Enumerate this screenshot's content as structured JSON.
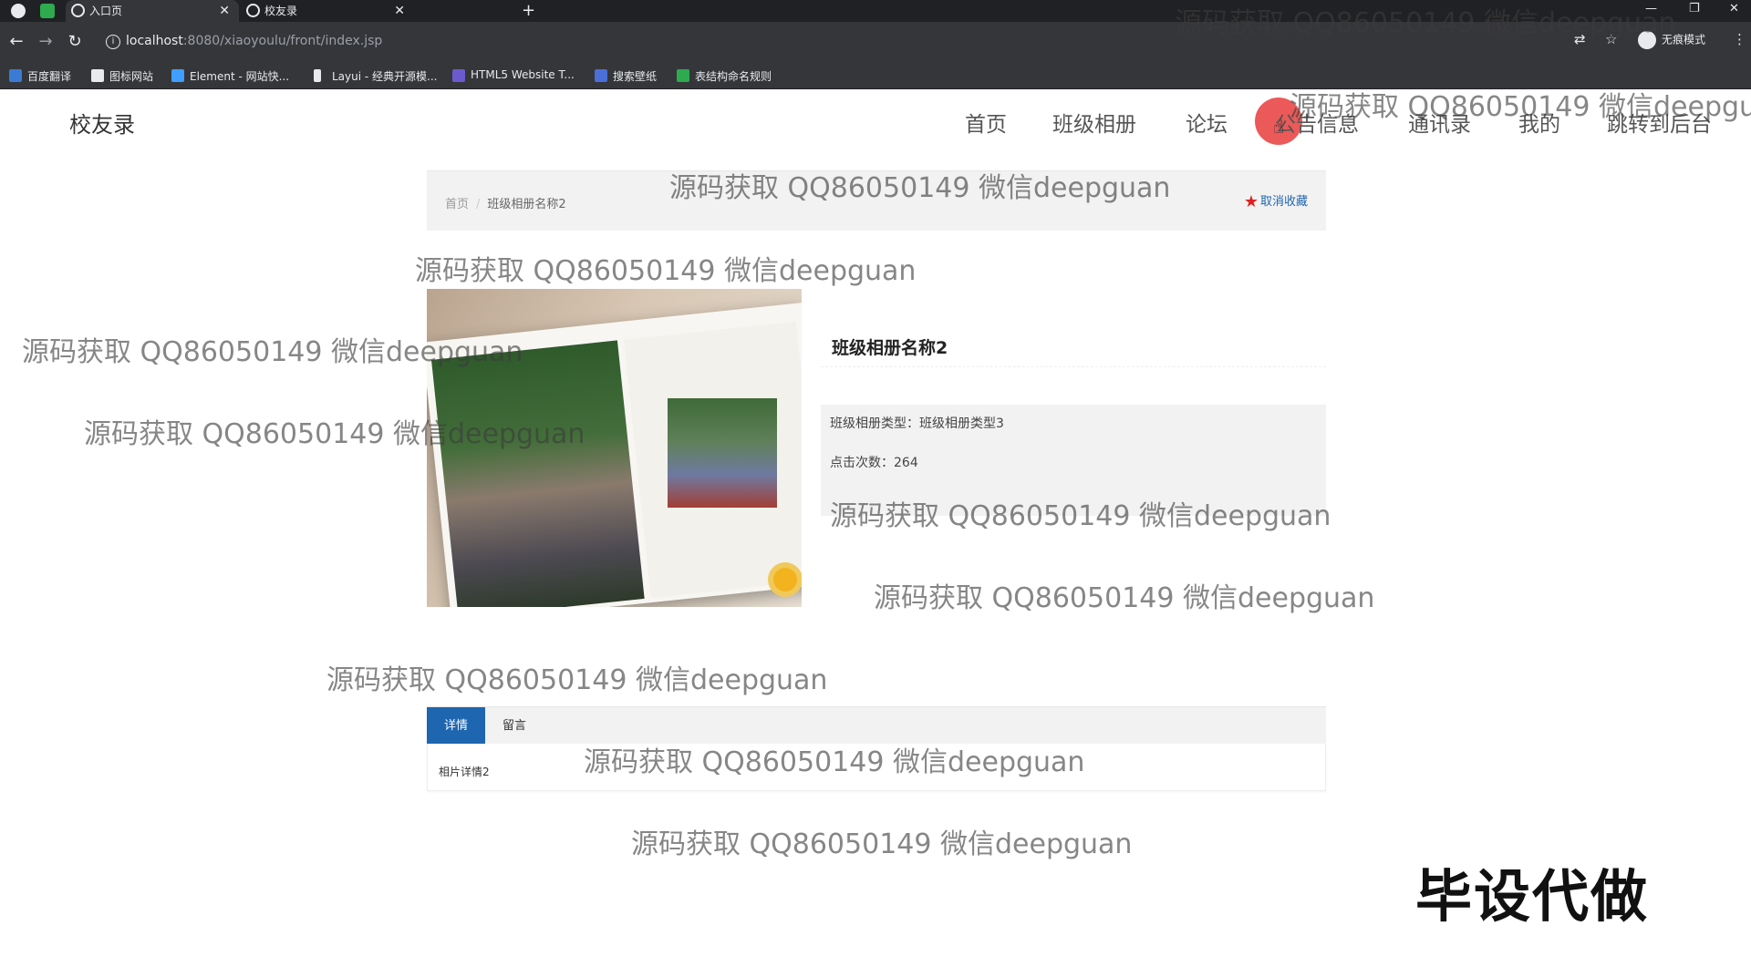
{
  "browser": {
    "tabs": [
      {
        "label": "入口页",
        "active": true
      },
      {
        "label": "校友录",
        "active": false
      }
    ],
    "new_tab": "+",
    "url_host": "localhost",
    "url_rest": ":8080/xiaoyoulu/front/index.jsp",
    "incognito_label": "无痕模式",
    "bookmarks": [
      {
        "label": "百度翻译",
        "color": "#3a7bd5"
      },
      {
        "label": "图标网站",
        "color": "#e8eaed"
      },
      {
        "label": "Element - 网站快...",
        "color": "#409eff"
      },
      {
        "label": "Layui - 经典开源模...",
        "color": "#e8eaed"
      },
      {
        "label": "HTML5 Website T...",
        "color": "#6a5acd"
      },
      {
        "label": "搜索壁纸",
        "color": "#4a6fd8"
      },
      {
        "label": "表结构命名规则",
        "color": "#2eaa4f"
      }
    ]
  },
  "site": {
    "brand": "校友录",
    "nav": [
      "首页",
      "班级相册",
      "论坛",
      "公告信息",
      "通讯录",
      "我的",
      "跳转到后台"
    ],
    "accent_color": "#1e66b0"
  },
  "breadcrumb": {
    "home": "首页",
    "separator": "/",
    "current": "班级相册名称2"
  },
  "favorite": {
    "star": "★",
    "label": "取消收藏"
  },
  "album": {
    "title": "班级相册名称2",
    "type_line": "班级相册类型：班级相册类型3",
    "clicks_label": "点击次数：",
    "clicks": "264"
  },
  "detail_tabs": {
    "active": "详情",
    "other": "留言",
    "content": "相片详情2"
  },
  "watermark": "源码获取 QQ86050149 微信deepguan",
  "stamp": "毕设代做"
}
